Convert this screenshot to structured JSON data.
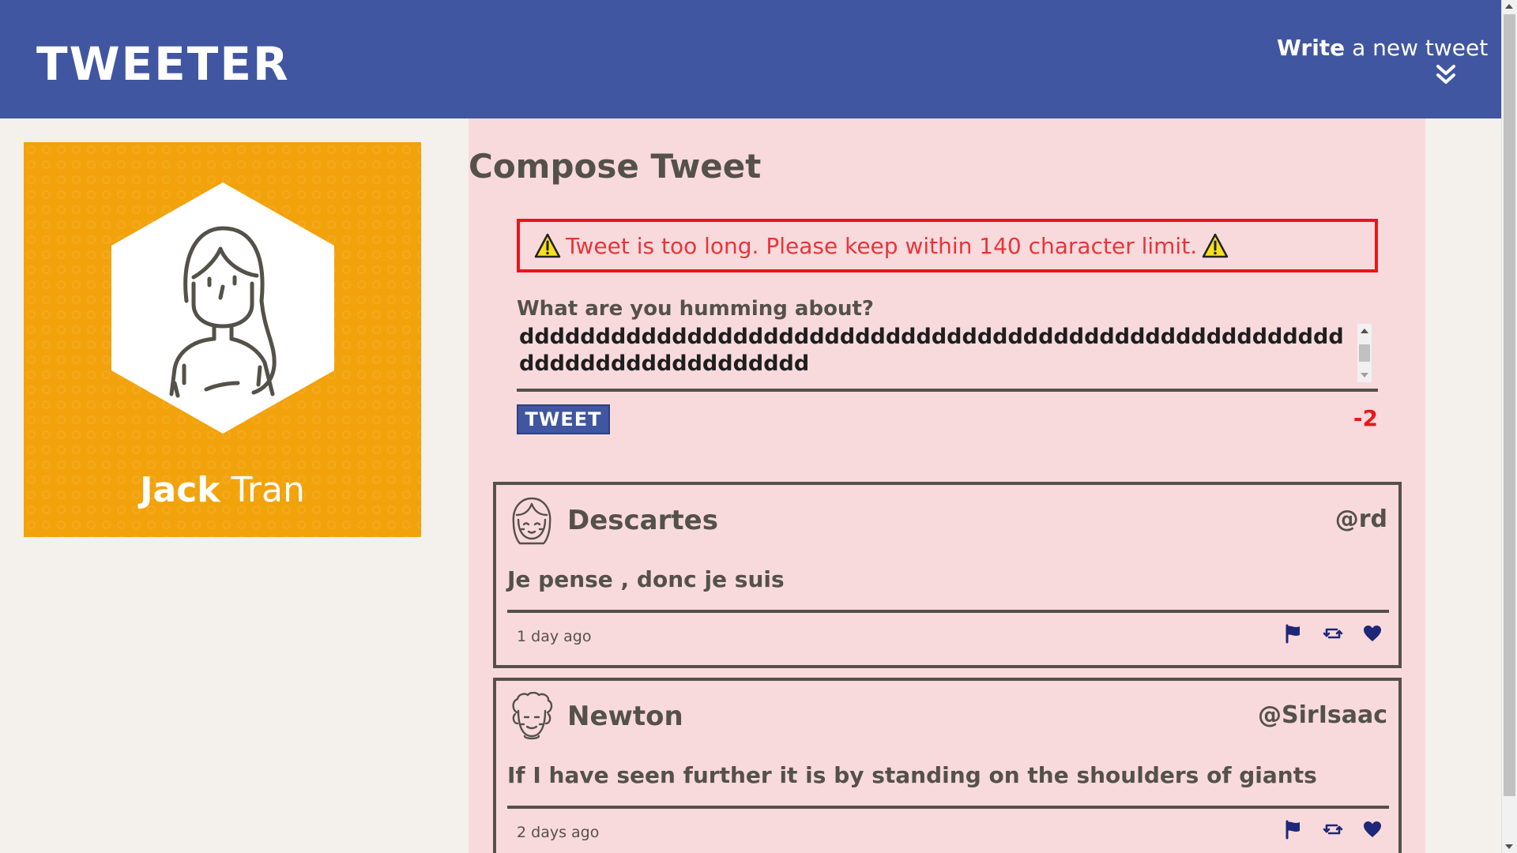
{
  "nav": {
    "brand": "TWEETER",
    "write_bold": "Write",
    "write_rest": " a new tweet",
    "write_icon": "chevron-double-down-icon"
  },
  "profile": {
    "first_name": "Jack",
    "last_name": " Tran",
    "background_color": "#f2a20a"
  },
  "compose": {
    "title": "Compose Tweet",
    "error_message": "Tweet is too long. Please keep within 140 character limit.",
    "label": "What are you humming about?",
    "text": "ddddddddddddddddddddddddddddddddddddddddddddddddddddddddddddddddddddddddd",
    "button_label": "TWEET",
    "counter": "-2"
  },
  "tweets": [
    {
      "author": "Descartes",
      "handle": "@rd",
      "content": "Je pense , donc je suis",
      "time": "1 day ago",
      "avatar": "descartes-avatar-icon"
    },
    {
      "author": "Newton",
      "handle": "@SirIsaac",
      "content": "If I have seen further it is by standing on the shoulders of giants",
      "time": "2 days ago",
      "avatar": "newton-avatar-icon"
    }
  ],
  "colors": {
    "nav": "#4056a1",
    "main_bg": "#f9dadc",
    "page_bg": "#f4f1ec",
    "error": "#e8161a",
    "action_icons": "#1e2778"
  }
}
